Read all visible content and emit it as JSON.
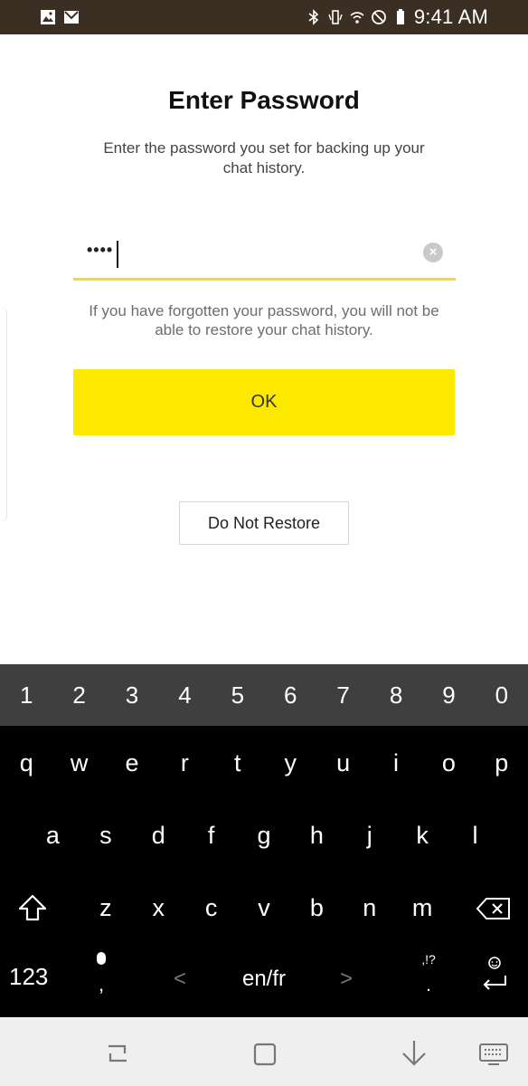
{
  "status_bar": {
    "left_icons": [
      "gallery-icon",
      "gmail-icon"
    ],
    "right_icons": [
      "bluetooth-icon",
      "vibrate-icon",
      "wifi-icon",
      "do-not-disturb-icon",
      "battery-icon"
    ],
    "time": "9:41 AM"
  },
  "dialog": {
    "title": "Enter Password",
    "subtitle": "Enter the password you set for backing up your chat history.",
    "password_value": "••••",
    "warning": "If you have forgotten your password, you will not be able to restore your chat history.",
    "ok_label": "OK",
    "do_not_restore_label": "Do Not Restore",
    "accent_color": "#fde800"
  },
  "keyboard": {
    "number_row": [
      "1",
      "2",
      "3",
      "4",
      "5",
      "6",
      "7",
      "8",
      "9",
      "0"
    ],
    "row1": [
      "q",
      "w",
      "e",
      "r",
      "t",
      "y",
      "u",
      "i",
      "o",
      "p"
    ],
    "row2": [
      "a",
      "s",
      "d",
      "f",
      "g",
      "h",
      "j",
      "k",
      "l"
    ],
    "row3": [
      "z",
      "x",
      "c",
      "v",
      "b",
      "n",
      "m"
    ],
    "symbols_key": "123",
    "comma": ",",
    "language_key": "en/fr",
    "arrow_left": "<",
    "arrow_right": ">",
    "punctuation": ",!?",
    "period": "."
  },
  "nav_bar": {
    "icons": [
      "recent-apps-icon",
      "home-icon",
      "back-icon",
      "keyboard-toggle-icon"
    ]
  }
}
